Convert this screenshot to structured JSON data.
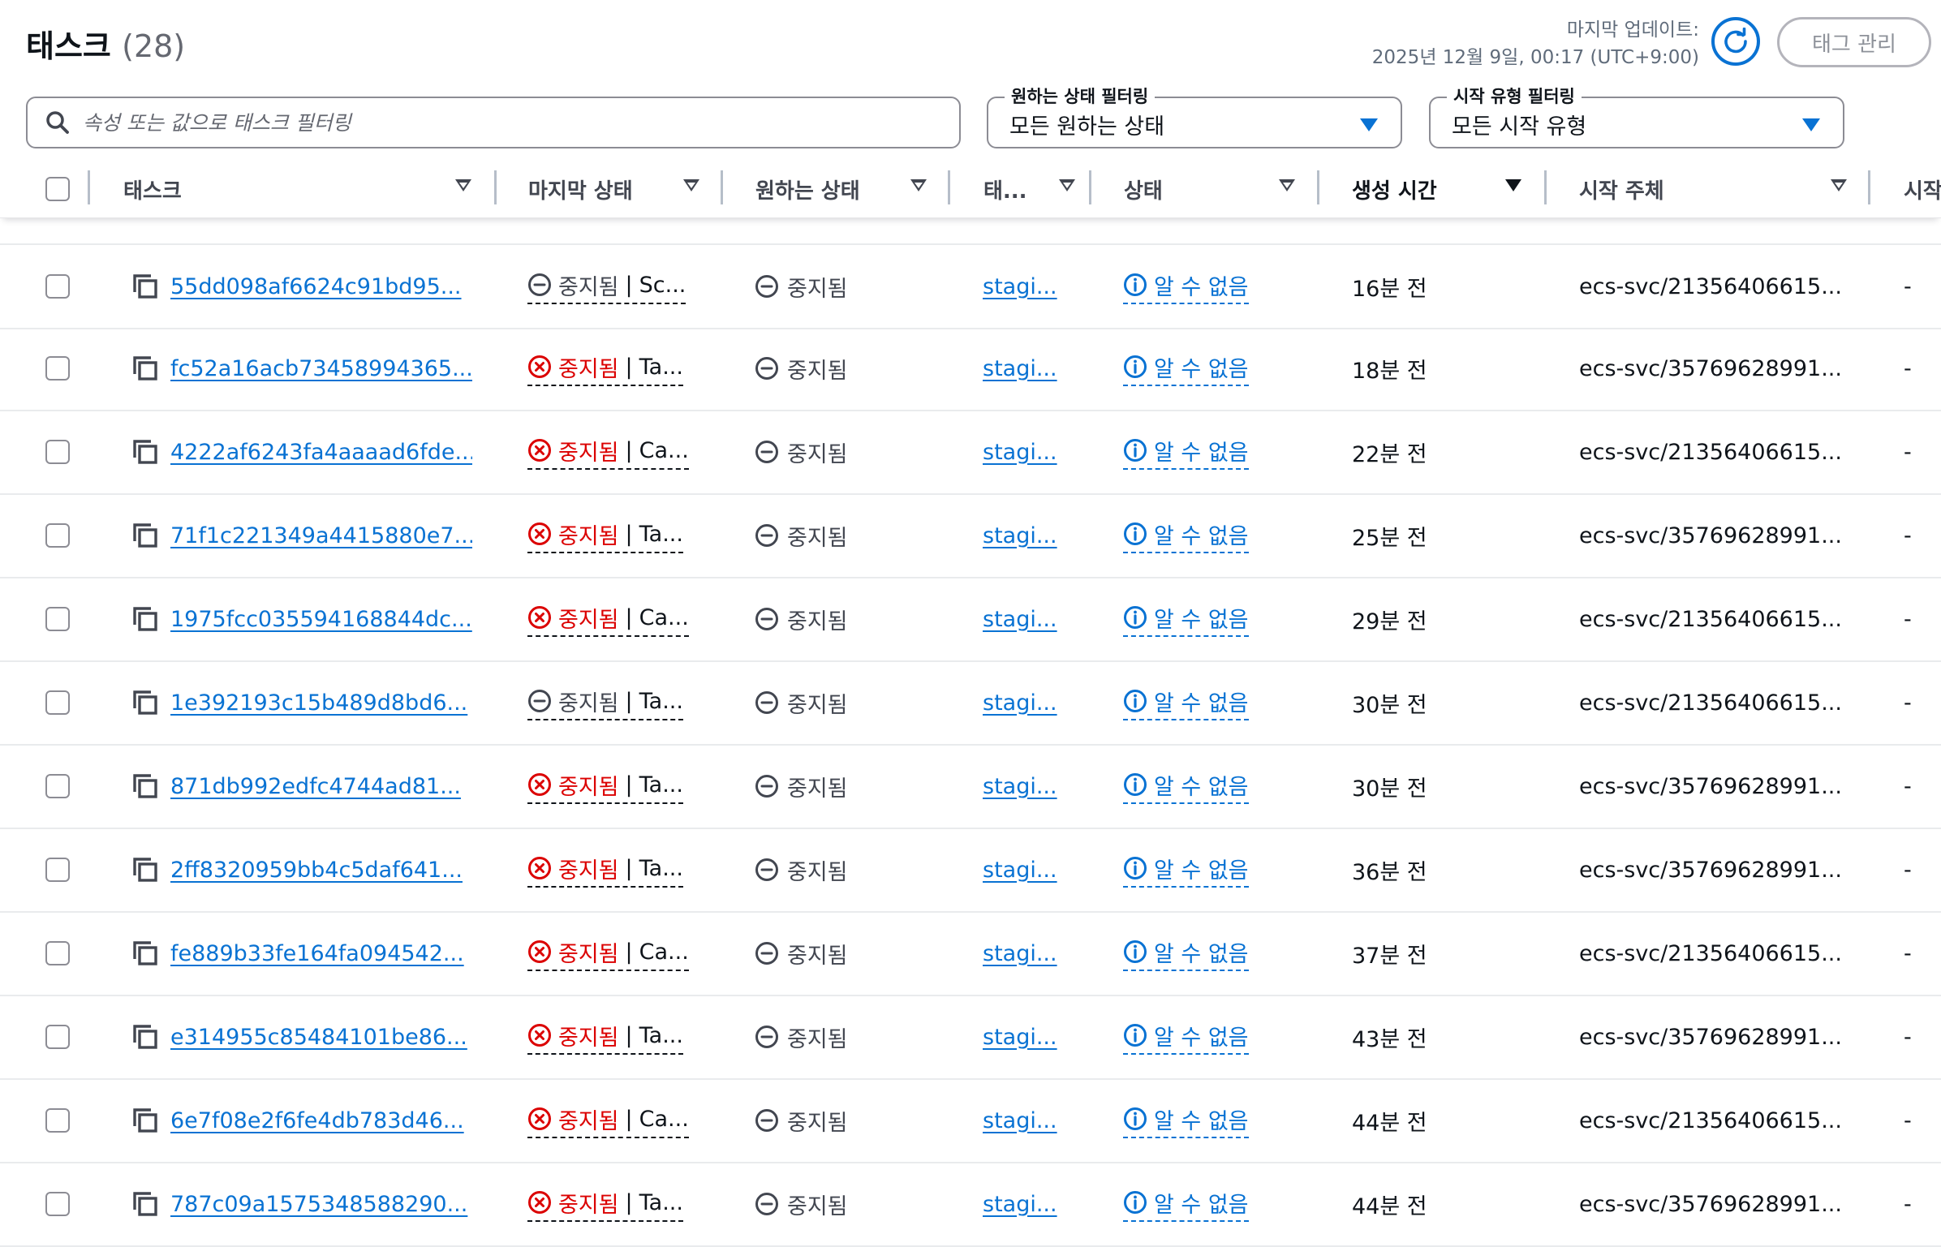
{
  "header": {
    "title": "태스크",
    "count": "(28)",
    "updated_label": "마지막 업데이트:",
    "updated_time": "2025년 12월 9일, 00:17 (UTC+9:00)",
    "tag_button": "태그 관리"
  },
  "filters": {
    "search_placeholder": "속성 또는 값으로 태스크 필터링",
    "desired_legend": "원하는 상태 필터링",
    "desired_value": "모든 원하는 상태",
    "launch_legend": "시작 유형 필터링",
    "launch_value": "모든 시작 유형"
  },
  "columns": {
    "task": "태스크",
    "last_status": "마지막 상태",
    "desired_status": "원하는 상태",
    "task_def": "태...",
    "health": "상태",
    "created": "생성 시간",
    "started_by": "시작 주체",
    "launch": "시작"
  },
  "colors": {
    "link": "#0972d3",
    "error": "#db0000",
    "neutral": "#424650"
  },
  "rows": [
    {
      "id": "55dd098af6624c91bd95...",
      "status_icon": "stopped-neutral-icon",
      "status": "중지됨",
      "reason": "Sc...",
      "desired": "중지됨",
      "taskdef": "stagi...",
      "health": "알 수 없음",
      "created": "16분 전",
      "started_by": "ecs-svc/21356406615...",
      "launch": "-"
    },
    {
      "id": "fc52a16acb73458994365...",
      "status_icon": "error-icon",
      "status": "중지됨",
      "reason": "Ta...",
      "desired": "중지됨",
      "taskdef": "stagi...",
      "health": "알 수 없음",
      "created": "18분 전",
      "started_by": "ecs-svc/35769628991...",
      "launch": "-"
    },
    {
      "id": "4222af6243fa4aaaad6fde...",
      "status_icon": "error-icon",
      "status": "중지됨",
      "reason": "Ca...",
      "desired": "중지됨",
      "taskdef": "stagi...",
      "health": "알 수 없음",
      "created": "22분 전",
      "started_by": "ecs-svc/21356406615...",
      "launch": "-"
    },
    {
      "id": "71f1c221349a4415880e7...",
      "status_icon": "error-icon",
      "status": "중지됨",
      "reason": "Ta...",
      "desired": "중지됨",
      "taskdef": "stagi...",
      "health": "알 수 없음",
      "created": "25분 전",
      "started_by": "ecs-svc/35769628991...",
      "launch": "-"
    },
    {
      "id": "1975fcc035594168844dc...",
      "status_icon": "error-icon",
      "status": "중지됨",
      "reason": "Ca...",
      "desired": "중지됨",
      "taskdef": "stagi...",
      "health": "알 수 없음",
      "created": "29분 전",
      "started_by": "ecs-svc/21356406615...",
      "launch": "-"
    },
    {
      "id": "1e392193c15b489d8bd6...",
      "status_icon": "stopped-neutral-icon",
      "status": "중지됨",
      "reason": "Ta...",
      "desired": "중지됨",
      "taskdef": "stagi...",
      "health": "알 수 없음",
      "created": "30분 전",
      "started_by": "ecs-svc/21356406615...",
      "launch": "-"
    },
    {
      "id": "871db992edfc4744ad81...",
      "status_icon": "error-icon",
      "status": "중지됨",
      "reason": "Ta...",
      "desired": "중지됨",
      "taskdef": "stagi...",
      "health": "알 수 없음",
      "created": "30분 전",
      "started_by": "ecs-svc/35769628991...",
      "launch": "-"
    },
    {
      "id": "2ff8320959bb4c5daf641...",
      "status_icon": "error-icon",
      "status": "중지됨",
      "reason": "Ta...",
      "desired": "중지됨",
      "taskdef": "stagi...",
      "health": "알 수 없음",
      "created": "36분 전",
      "started_by": "ecs-svc/35769628991...",
      "launch": "-"
    },
    {
      "id": "fe889b33fe164fa094542...",
      "status_icon": "error-icon",
      "status": "중지됨",
      "reason": "Ca...",
      "desired": "중지됨",
      "taskdef": "stagi...",
      "health": "알 수 없음",
      "created": "37분 전",
      "started_by": "ecs-svc/21356406615...",
      "launch": "-"
    },
    {
      "id": "e314955c85484101be86...",
      "status_icon": "error-icon",
      "status": "중지됨",
      "reason": "Ta...",
      "desired": "중지됨",
      "taskdef": "stagi...",
      "health": "알 수 없음",
      "created": "43분 전",
      "started_by": "ecs-svc/35769628991...",
      "launch": "-"
    },
    {
      "id": "6e7f08e2f6fe4db783d46...",
      "status_icon": "error-icon",
      "status": "중지됨",
      "reason": "Ca...",
      "desired": "중지됨",
      "taskdef": "stagi...",
      "health": "알 수 없음",
      "created": "44분 전",
      "started_by": "ecs-svc/21356406615...",
      "launch": "-"
    },
    {
      "id": "787c09a1575348588290...",
      "status_icon": "error-icon",
      "status": "중지됨",
      "reason": "Ta...",
      "desired": "중지됨",
      "taskdef": "stagi...",
      "health": "알 수 없음",
      "created": "44분 전",
      "started_by": "ecs-svc/35769628991...",
      "launch": "-"
    }
  ]
}
